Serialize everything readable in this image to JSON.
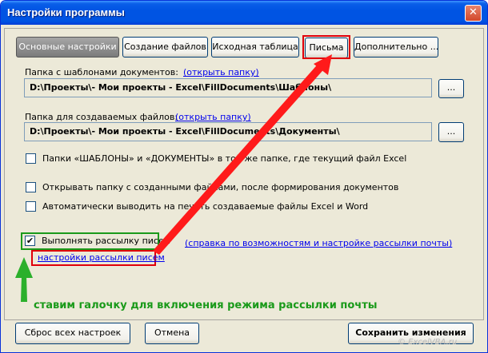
{
  "window": {
    "title": "Настройки программы",
    "close_glyph": "✕"
  },
  "tabs": [
    {
      "label": "Основные настройки",
      "active": true
    },
    {
      "label": "Создание файлов",
      "active": false
    },
    {
      "label": "Исходная таблица",
      "active": false
    },
    {
      "label": "Письма",
      "active": false,
      "highlighted": true
    },
    {
      "label": "Дополнительно ...",
      "active": false
    }
  ],
  "templates": {
    "label": "Папка с шаблонами документов:",
    "open_link": "(открыть папку)",
    "path": "D:\\Проекты\\- Мои проекты - Excel\\FillDocuments\\Шаблоны\\",
    "browse_label": "..."
  },
  "output": {
    "label": "Папка для создаваемых файлов:",
    "open_link": "(открыть папку)",
    "path": "D:\\Проекты\\- Мои проекты - Excel\\FillDocuments\\Документы\\",
    "browse_label": "..."
  },
  "options": [
    {
      "label": "Папки «ШАБЛОНЫ» и «ДОКУМЕНТЫ» в той же папке, где текущий файл Excel",
      "checked": false
    },
    {
      "label": "Открывать папку с созданными файлами, после формирования документов",
      "checked": false
    },
    {
      "label": "Автоматически выводить на печать создаваемые файлы Excel и Word",
      "checked": false
    }
  ],
  "mailing": {
    "label": "Выполнять рассылку писем",
    "checked": true,
    "check_glyph": "✔",
    "settings_link": "настройки рассылки писем",
    "help_link": "(справка по возможностям и настройке рассылки почты)"
  },
  "annotation": "ставим галочку для включения режима рассылки почты",
  "footer": {
    "reset_label": "Сброс всех настроек",
    "cancel_label": "Отмена",
    "save_label": "Сохранить изменения"
  },
  "colors": {
    "highlight_red": "#e0000a",
    "highlight_green": "#1a9a1a",
    "arrow_red": "#ff1a1a",
    "arrow_green": "#2bb02b"
  },
  "watermark": "© ExcelVBA.ru"
}
